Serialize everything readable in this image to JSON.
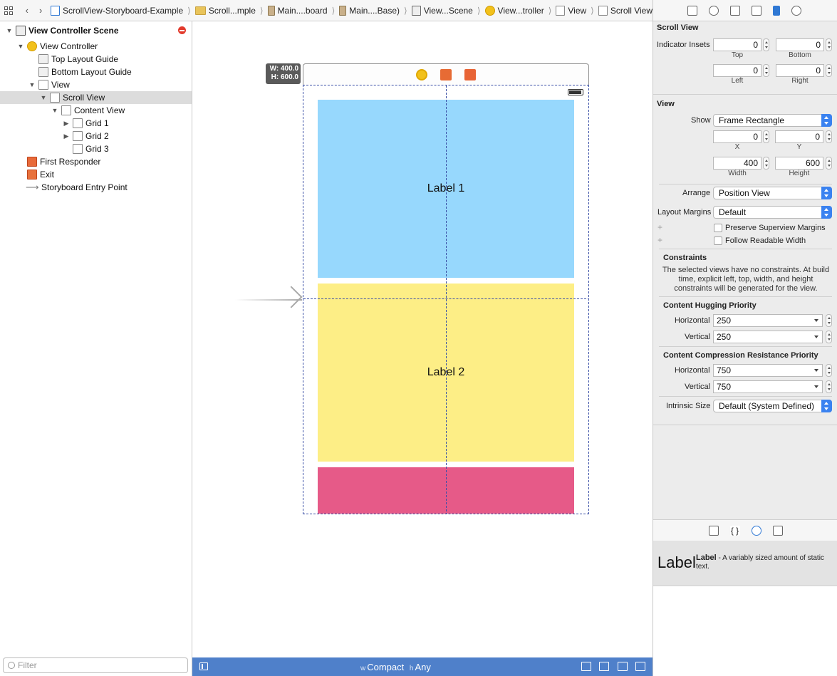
{
  "jumpbar": {
    "crumbs": [
      "ScrollView-Storyboard-Example",
      "Scroll...mple",
      "Main....board",
      "Main....Base)",
      "View...Scene",
      "View...troller",
      "View",
      "Scroll View"
    ]
  },
  "outline": {
    "items": [
      {
        "label": "View Controller Scene"
      },
      {
        "label": "View Controller"
      },
      {
        "label": "Top Layout Guide"
      },
      {
        "label": "Bottom Layout Guide"
      },
      {
        "label": "View"
      },
      {
        "label": "Scroll View"
      },
      {
        "label": "Content View"
      },
      {
        "label": "Grid 1"
      },
      {
        "label": "Grid 2"
      },
      {
        "label": "Grid 3"
      },
      {
        "label": "First Responder"
      },
      {
        "label": "Exit"
      },
      {
        "label": "Storyboard Entry Point"
      }
    ],
    "filter_placeholder": "Filter"
  },
  "canvas": {
    "size_w": "W: 400.0",
    "size_h": "H: 600.0",
    "grid1_label": "Label 1",
    "grid2_label": "Label 2",
    "grid1_color": "#97d8fd",
    "grid2_color": "#fdee86",
    "grid3_color": "#e65a88"
  },
  "sizebar": {
    "w_prefix": "w",
    "w_value": "Compact",
    "h_prefix": "h",
    "h_value": "Any"
  },
  "inspector": {
    "scroll_view": {
      "title": "Scroll View",
      "indicator_insets_label": "Indicator Insets",
      "top": "0",
      "top_label": "Top",
      "bottom": "0",
      "bottom_label": "Bottom",
      "left": "0",
      "left_label": "Left",
      "right": "0",
      "right_label": "Right"
    },
    "view": {
      "title": "View",
      "show_label": "Show",
      "show_value": "Frame Rectangle",
      "x": "0",
      "x_label": "X",
      "y": "0",
      "y_label": "Y",
      "width": "400",
      "width_label": "Width",
      "height": "600",
      "height_label": "Height",
      "arrange_label": "Arrange",
      "arrange_value": "Position View",
      "margins_label": "Layout Margins",
      "margins_value": "Default",
      "preserve_label": "Preserve Superview Margins",
      "readable_label": "Follow Readable Width"
    },
    "constraints": {
      "title": "Constraints",
      "description": "The selected views have no constraints. At build time, explicit left, top, width, and height constraints will be generated for the view."
    },
    "hugging": {
      "title": "Content Hugging Priority",
      "h_label": "Horizontal",
      "h_value": "250",
      "v_label": "Vertical",
      "v_value": "250"
    },
    "compression": {
      "title": "Content Compression Resistance Priority",
      "h_label": "Horizontal",
      "h_value": "750",
      "v_label": "Vertical",
      "v_value": "750"
    },
    "intrinsic": {
      "label": "Intrinsic Size",
      "value": "Default (System Defined)"
    }
  },
  "library": {
    "big_label": "Label",
    "item_name": "Label",
    "item_desc": " - A variably sized amount of static text."
  }
}
